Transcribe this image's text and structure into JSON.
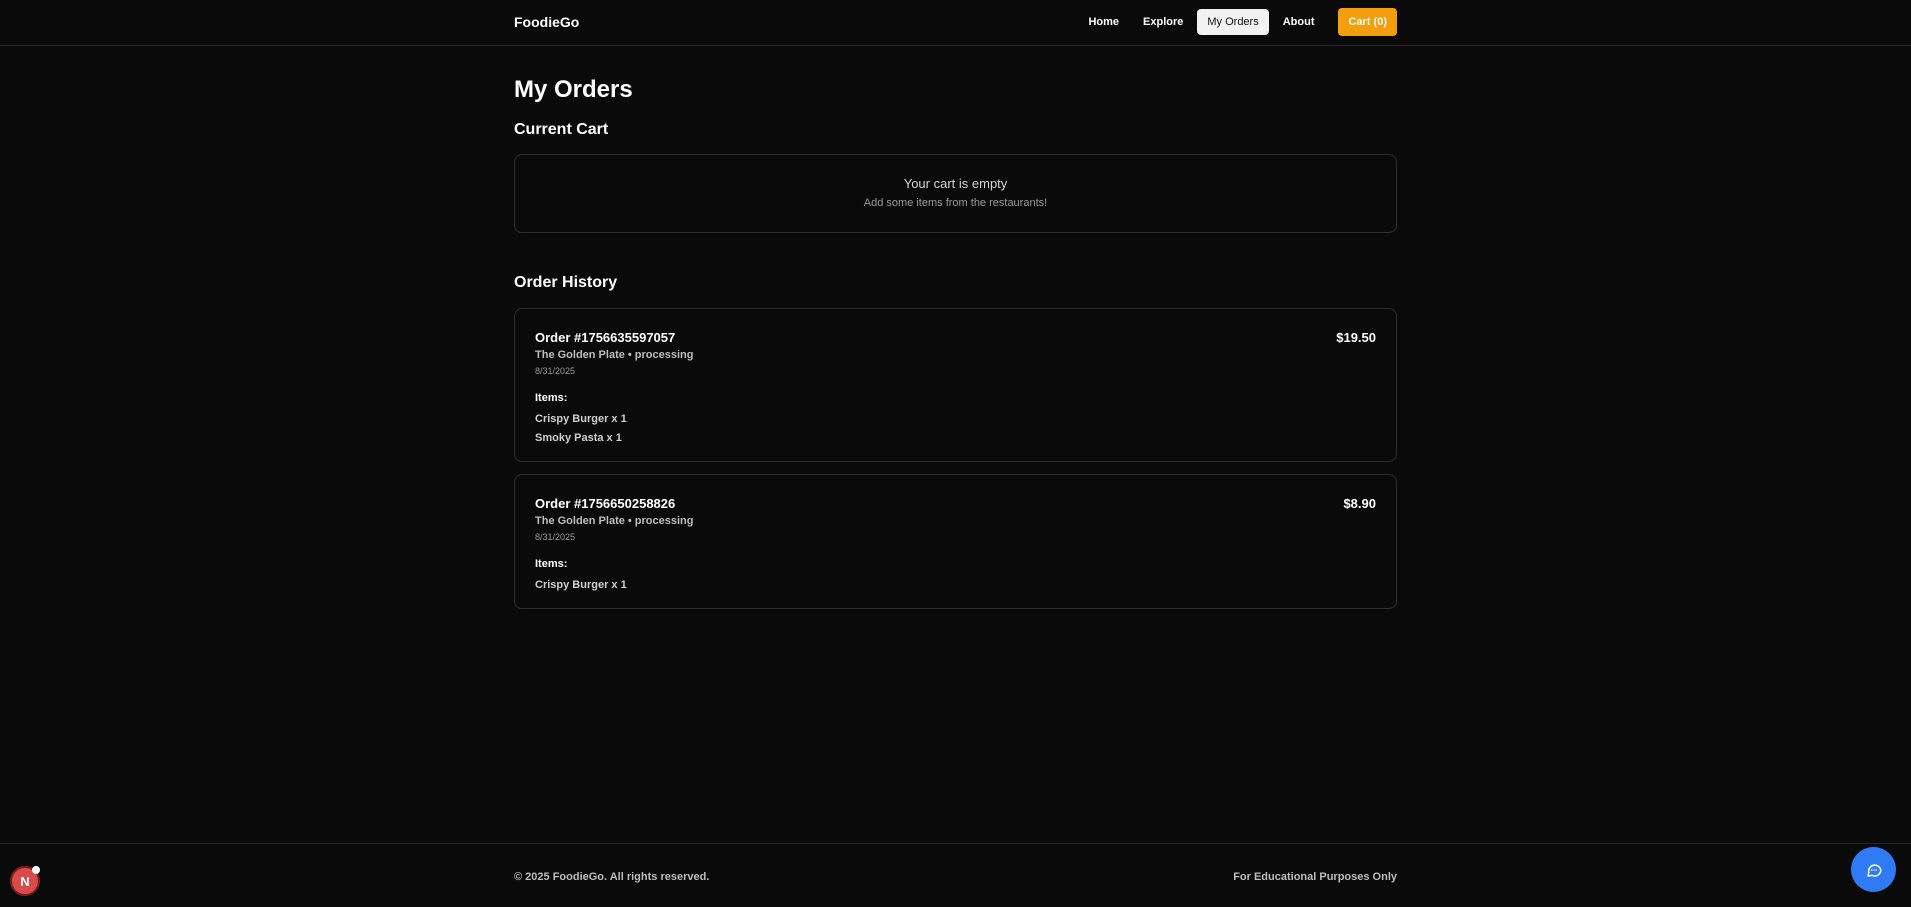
{
  "header": {
    "brand": "FoodieGo",
    "nav": {
      "home": "Home",
      "explore": "Explore",
      "my_orders": "My Orders",
      "about": "About",
      "cart": "Cart (0)"
    }
  },
  "page": {
    "title": "My Orders"
  },
  "current_cart": {
    "heading": "Current Cart",
    "empty_title": "Your cart is empty",
    "empty_hint": "Add some items from the restaurants!"
  },
  "order_history": {
    "heading": "Order History",
    "orders": [
      {
        "id": "Order #1756635597057",
        "total": "$19.50",
        "meta": "The Golden Plate • processing",
        "date": "8/31/2025",
        "items_label": "Items:",
        "items": [
          "Crispy Burger x 1",
          "Smoky Pasta x 1"
        ]
      },
      {
        "id": "Order #1756650258826",
        "total": "$8.90",
        "meta": "The Golden Plate • processing",
        "date": "8/31/2025",
        "items_label": "Items:",
        "items": [
          "Crispy Burger x 1"
        ]
      }
    ]
  },
  "footer": {
    "copyright": "© 2025 FoodieGo. All rights reserved.",
    "note": "For Educational Purposes Only"
  },
  "widgets": {
    "devtools_letter": "N",
    "devtools_icon": "nextjs-icon",
    "chat_icon": "chat-bubble-icon"
  },
  "colors": {
    "background": "#0a0a0a",
    "accent": "#f59e0b",
    "chat": "#2f7bf5",
    "devtools": "#d94a4a"
  }
}
